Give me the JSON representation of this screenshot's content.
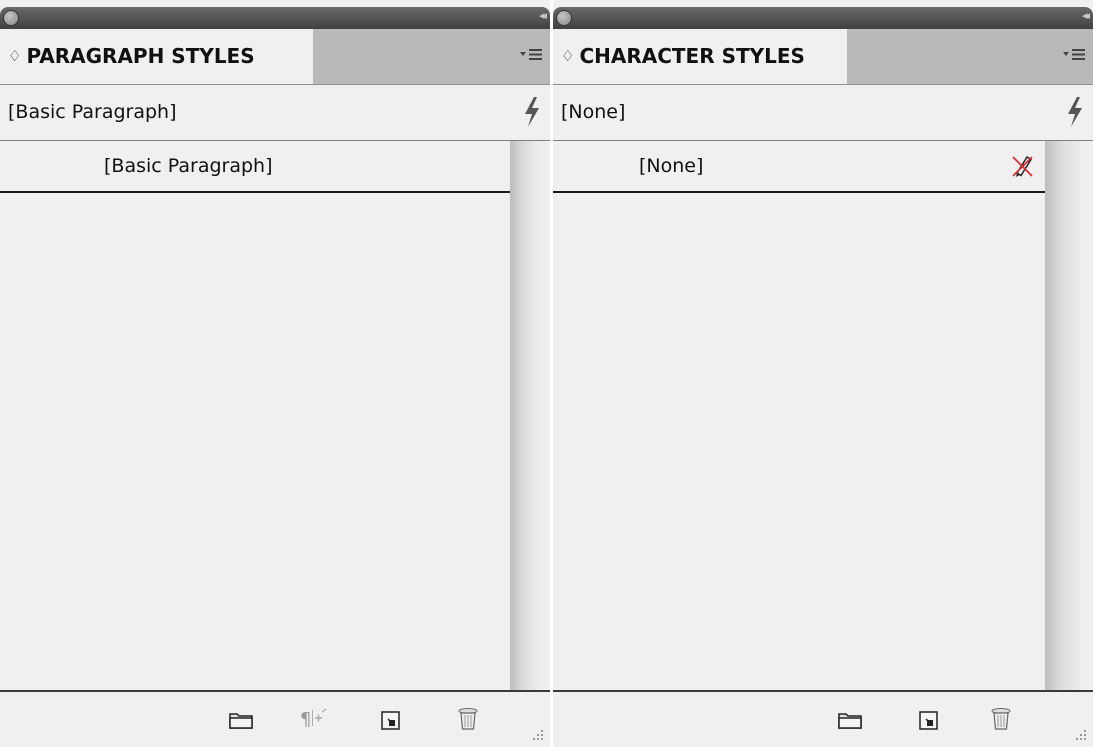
{
  "paragraph_panel": {
    "tab_title": "PARAGRAPH STYLES",
    "tab_arrows": "♢",
    "current_style": "[Basic Paragraph]",
    "styles": [
      {
        "label": "[Basic Paragraph]"
      }
    ],
    "footer_icons": [
      "folder-icon",
      "clear-overrides-icon",
      "new-style-icon",
      "trash-icon"
    ]
  },
  "character_panel": {
    "tab_title": "CHARACTER STYLES",
    "tab_arrows": "♢",
    "current_style": "[None]",
    "styles": [
      {
        "label": "[None]",
        "icon": "edit-disabled-icon"
      }
    ],
    "footer_icons": [
      "folder-icon",
      "new-style-icon",
      "trash-icon"
    ]
  },
  "titlebar": {
    "collapse_glyph": "◂◂"
  },
  "colors": {
    "titlebar": "#4f4f4f",
    "panel_bg": "#f0f0f0",
    "tabbar_bg": "#b9b9b9",
    "disabled_icon_red": "#d43030"
  }
}
